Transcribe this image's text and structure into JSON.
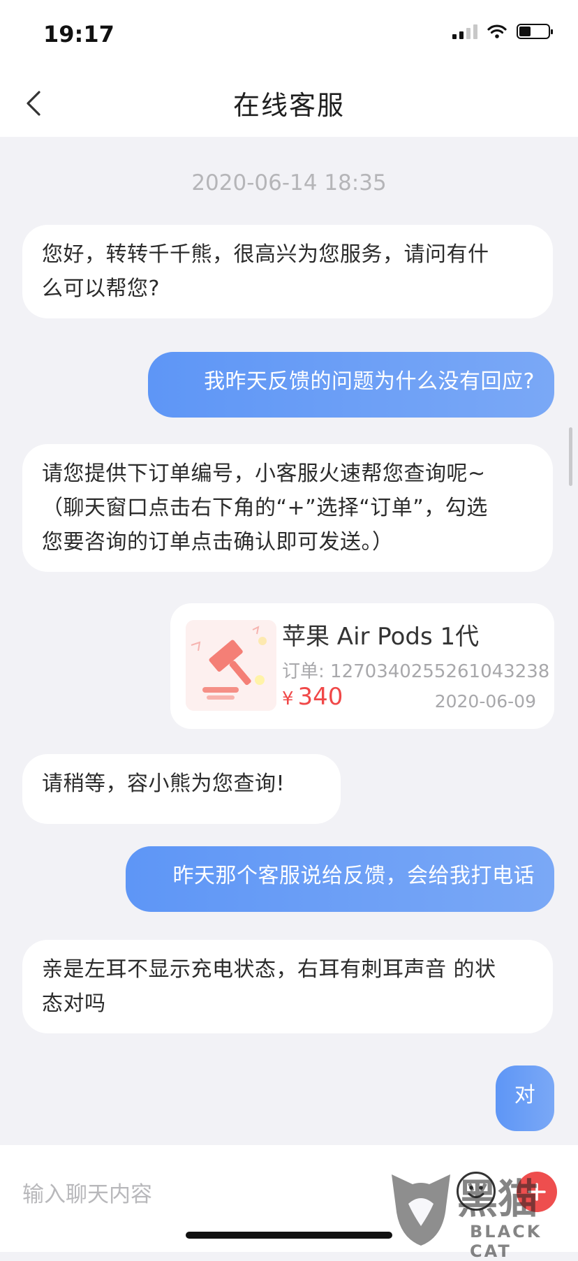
{
  "status_bar": {
    "time": "19:17"
  },
  "header": {
    "title": "在线客服"
  },
  "timestamp": "2020-06-14 18:35",
  "messages": [
    {
      "side": "left",
      "text": "您好，转转千千熊，很高兴为您服务，请问有什\n么可以帮您?"
    },
    {
      "side": "right",
      "text": "我昨天反馈的问题为什么没有回应?"
    },
    {
      "side": "left",
      "text": "请您提供下订单编号，小客服火速帮您查询呢~\n（聊天窗口点击右下角的“+”选择“订单”，勾选\n您要咨询的订单点击确认即可发送。）"
    },
    {
      "side": "left",
      "text": "请稍等，容小熊为您查询!"
    },
    {
      "side": "right",
      "text": "昨天那个客服说给反馈，会给我打电话"
    },
    {
      "side": "left",
      "text": "亲是左耳不显示充电状态，右耳有刺耳声音 的状\n态对吗"
    },
    {
      "side": "right",
      "text": "对"
    }
  ],
  "order_card": {
    "title": "苹果 Air Pods 1代",
    "order_number": "订单: 1270340255261043238",
    "currency": "¥",
    "price": "340",
    "date": "2020-06-09",
    "thumbnail_icon": "auction-hammer-icon"
  },
  "input": {
    "placeholder": "输入聊天内容"
  },
  "icons": {
    "back": "back-chevron-icon",
    "emoji": "emoji-icon",
    "plus": "plus-icon"
  },
  "watermark": {
    "cn": "黑猫",
    "en": "BLACK CAT"
  },
  "colors": {
    "accent_blue": "#6f9ff6",
    "price_red": "#f04848",
    "background": "#f2f2f6"
  }
}
